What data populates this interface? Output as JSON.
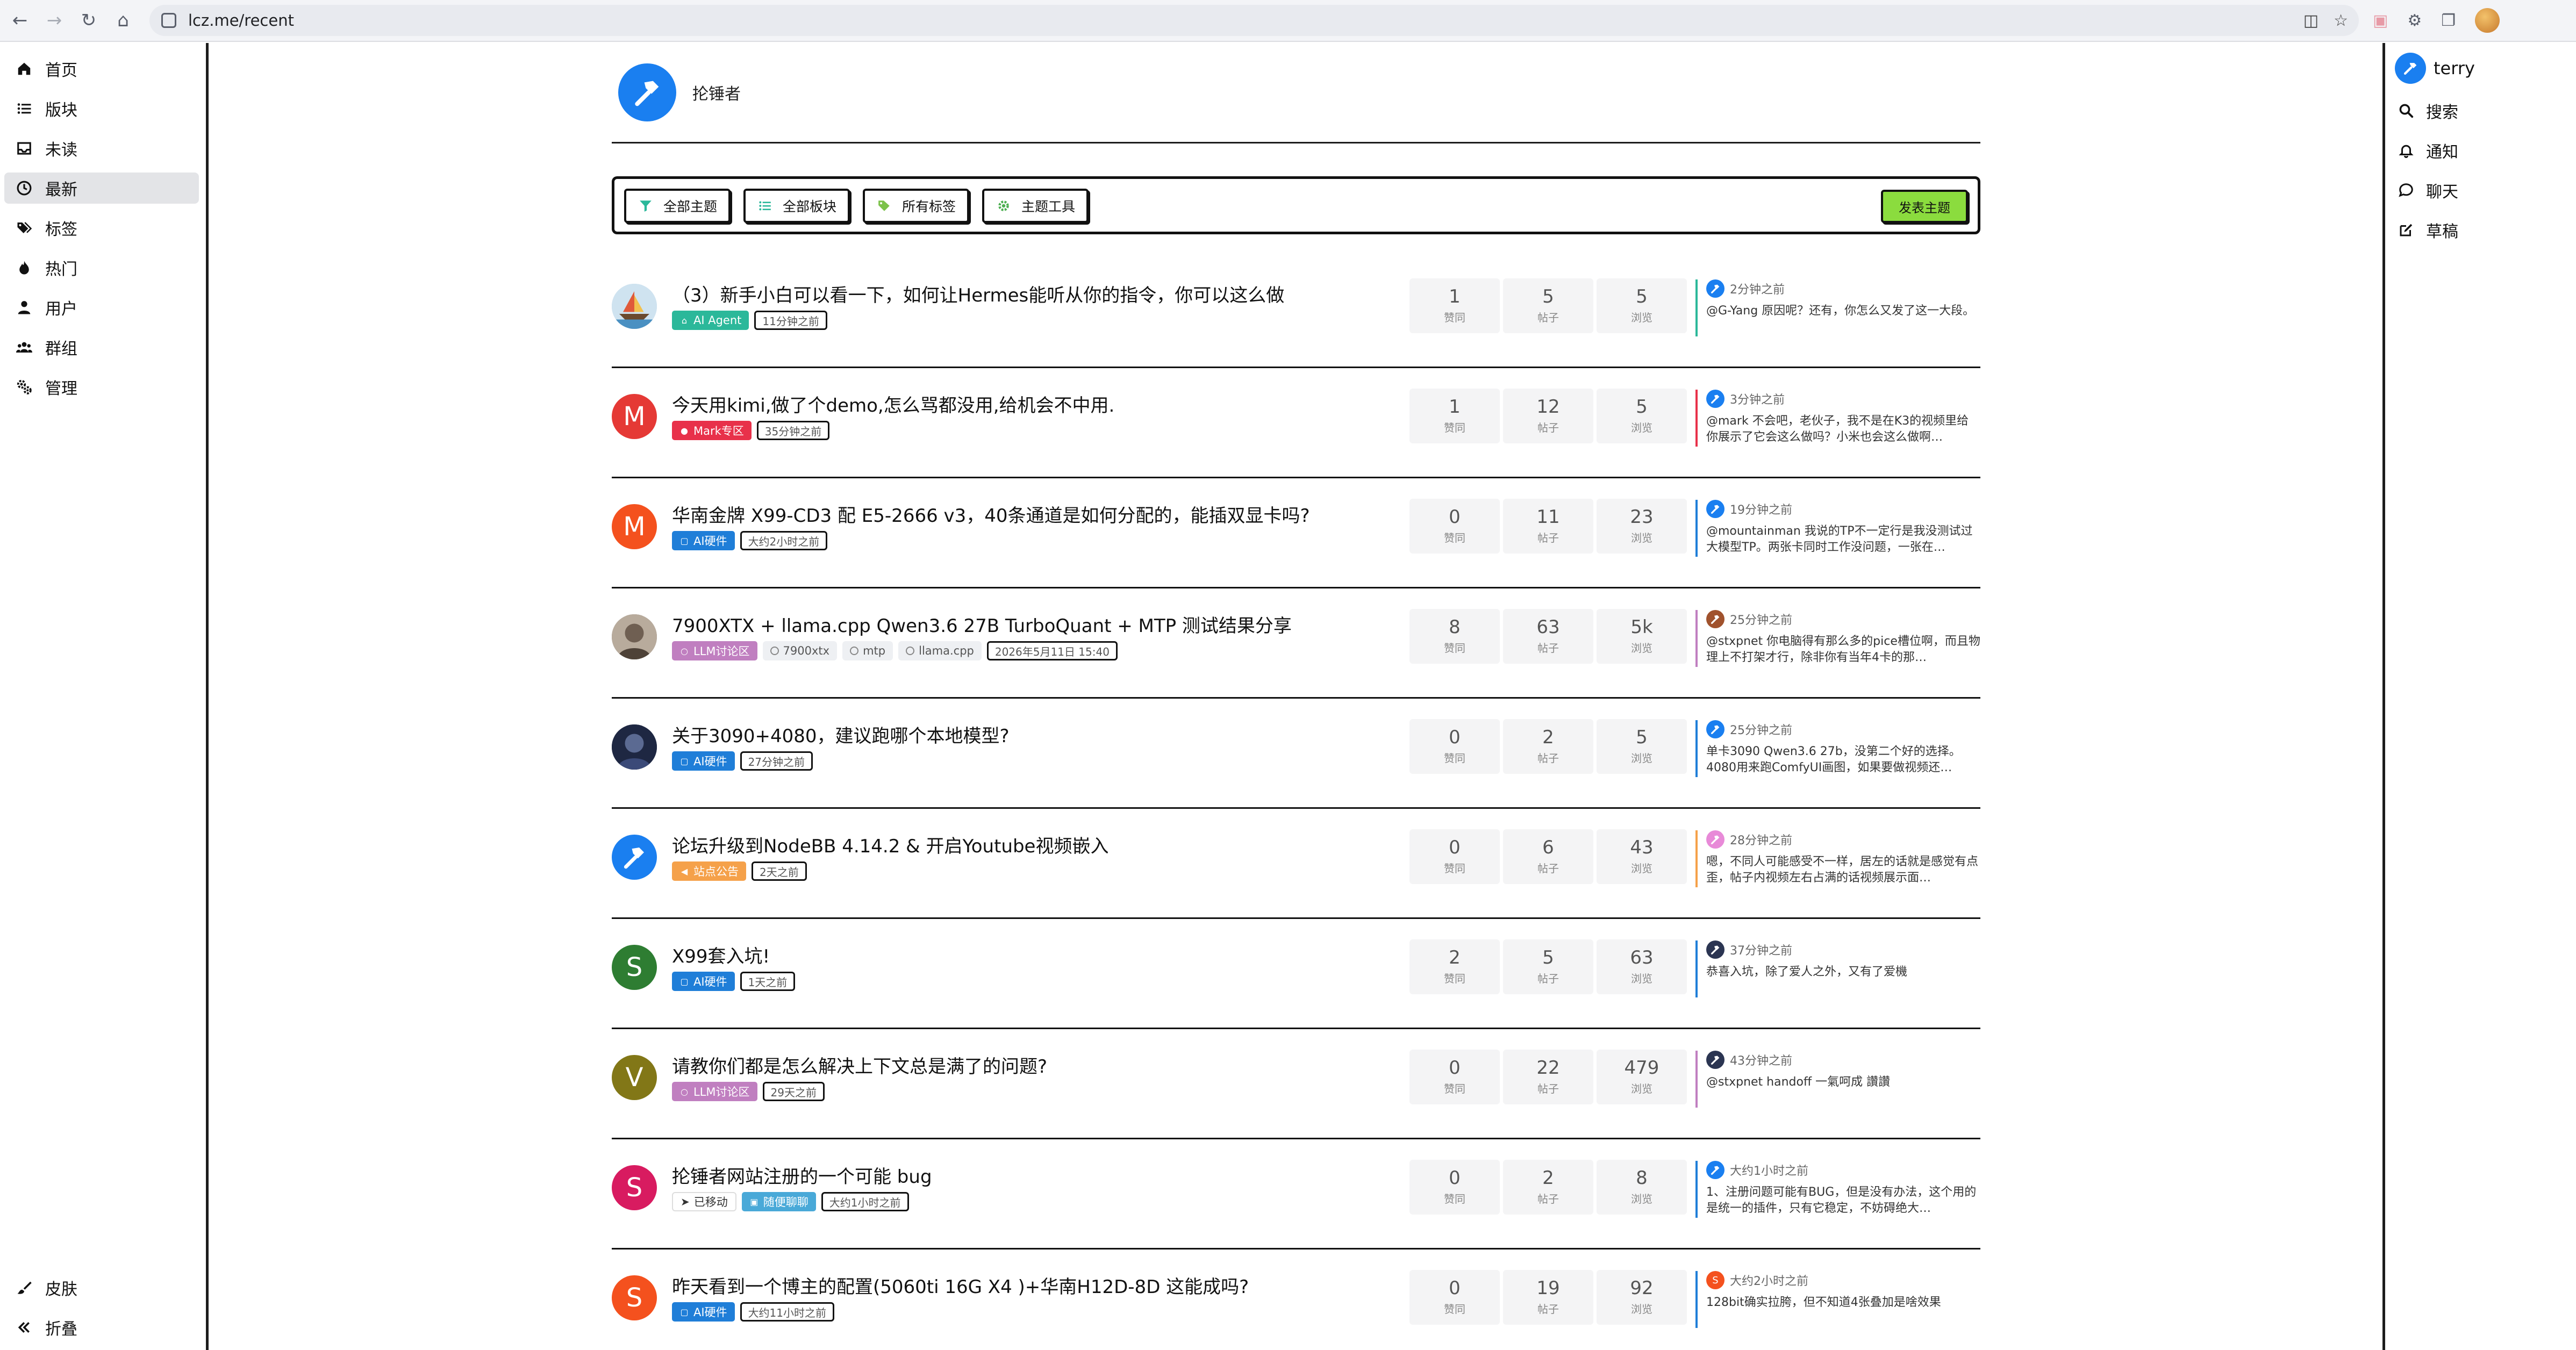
{
  "browser": {
    "url": "lcz.me/recent"
  },
  "left_nav": [
    {
      "id": "home",
      "label": "首页",
      "icon": "home-icon"
    },
    {
      "id": "categories",
      "label": "版块",
      "icon": "list-icon"
    },
    {
      "id": "unread",
      "label": "未读",
      "icon": "inbox-icon"
    },
    {
      "id": "recent",
      "label": "最新",
      "icon": "clock-icon",
      "active": true
    },
    {
      "id": "tags",
      "label": "标签",
      "icon": "tags-icon"
    },
    {
      "id": "popular",
      "label": "热门",
      "icon": "fire-icon"
    },
    {
      "id": "users",
      "label": "用户",
      "icon": "user-icon"
    },
    {
      "id": "groups",
      "label": "群组",
      "icon": "group-icon"
    },
    {
      "id": "admin",
      "label": "管理",
      "icon": "gears-icon"
    }
  ],
  "left_nav_bottom": [
    {
      "id": "skins",
      "label": "皮肤",
      "icon": "brush-icon"
    },
    {
      "id": "collapse",
      "label": "折叠",
      "icon": "double-chevron-left-icon"
    }
  ],
  "right_nav": {
    "username": "terry",
    "items": [
      {
        "id": "search",
        "label": "搜索",
        "icon": "search-icon"
      },
      {
        "id": "notifications",
        "label": "通知",
        "icon": "bell-icon"
      },
      {
        "id": "chat",
        "label": "聊天",
        "icon": "chat-icon"
      },
      {
        "id": "drafts",
        "label": "草稿",
        "icon": "pen-square-icon"
      }
    ]
  },
  "brand": {
    "name": "抡锤者"
  },
  "toolbar": {
    "filters": [
      {
        "id": "all-topics",
        "label": "全部主题",
        "icon": "filter-icon"
      },
      {
        "id": "all-categories",
        "label": "全部板块",
        "icon": "list-icon"
      },
      {
        "id": "all-tags",
        "label": "所有标签",
        "icon": "tag-icon"
      },
      {
        "id": "topic-tools",
        "label": "主题工具",
        "icon": "gear-icon"
      }
    ],
    "new_topic_label": "发表主题"
  },
  "stat_labels": {
    "votes": "赞同",
    "posts": "帖子",
    "views": "浏览"
  },
  "colors": {
    "accent_blue": "#1a7ff0",
    "new_topic_green": "#8bdc3e",
    "cat_ai_agent": "#2bb89a",
    "cat_mark": "#e8314a",
    "cat_ai_hardware": "#1f7ed8",
    "cat_llm": "#c07fc0",
    "cat_announcement": "#f5a14a",
    "cat_chat": "#49a9d8"
  },
  "topics": [
    {
      "title": "（3）新手小白可以看一下，如何让Hermes能听从你的指令，你可以这么做",
      "avatar": {
        "type": "image",
        "letter": "",
        "color": "#b8d4e8",
        "icon": "sailboat-avatar-icon"
      },
      "category": {
        "label": "AI Agent",
        "color": "#2bb89a",
        "icon": "robot-icon"
      },
      "tags": [],
      "time": "11分钟之前",
      "votes": "1",
      "posts": "5",
      "views": "5",
      "last_post": {
        "time": "2分钟之前",
        "text": "@G-Yang 原因呢？还有，你怎么又发了这一大段。",
        "avatar_color": "#1a7ff0",
        "avatar_letter": "",
        "border": "#2bb89a"
      }
    },
    {
      "title": "今天用kimi,做了个demo,怎么骂都没用,给机会不中用.",
      "avatar": {
        "type": "letter",
        "letter": "M",
        "color": "#e53935"
      },
      "category": {
        "label": "Mark专区",
        "color": "#e8314a",
        "icon": "person-icon"
      },
      "tags": [],
      "time": "35分钟之前",
      "votes": "1",
      "posts": "12",
      "views": "5",
      "last_post": {
        "time": "3分钟之前",
        "text": "@mark 不会吧，老伙子，我不是在K3的视频里给你展示了它会这么做吗？小米也会这么做啊…",
        "avatar_color": "#1a7ff0",
        "avatar_letter": "",
        "border": "#e8314a"
      }
    },
    {
      "title": "华南金牌 X99-CD3 配 E5-2666 v3，40条通道是如何分配的，能插双显卡吗?",
      "avatar": {
        "type": "letter",
        "letter": "M",
        "color": "#f4511e"
      },
      "category": {
        "label": "AI硬件",
        "color": "#1f7ed8",
        "icon": "monitor-icon"
      },
      "tags": [],
      "time": "大约2小时之前",
      "votes": "0",
      "posts": "11",
      "views": "23",
      "last_post": {
        "time": "19分钟之前",
        "text": "@mountainman 我说的TP不一定行是我没测试过大模型TP。两张卡同时工作没问题，一张在…",
        "avatar_color": "#1a7ff0",
        "avatar_letter": "",
        "border": "#1f7ed8"
      }
    },
    {
      "title": "7900XTX + llama.cpp Qwen3.6 27B TurboQuant + MTP 测试结果分享",
      "avatar": {
        "type": "image",
        "letter": "",
        "color": "#8a7f74",
        "icon": "person-photo-avatar-icon"
      },
      "category": {
        "label": "LLM讨论区",
        "color": "#c07fc0",
        "icon": "circle-icon"
      },
      "tags": [
        "7900xtx",
        "mtp",
        "llama.cpp"
      ],
      "time": "2026年5月11日 15:40",
      "votes": "8",
      "posts": "63",
      "views": "5k",
      "last_post": {
        "time": "25分钟之前",
        "text": "@stxpnet 你电脑得有那么多的pice槽位啊，而且物理上不打架才行，除非你有当年4卡的那…",
        "avatar_color": "#a0522d",
        "avatar_letter": "",
        "border": "#c07fc0"
      }
    },
    {
      "title": "关于3090+4080，建议跑哪个本地模型?",
      "avatar": {
        "type": "image",
        "letter": "",
        "color": "#2b3552",
        "icon": "dark-photo-avatar-icon"
      },
      "category": {
        "label": "AI硬件",
        "color": "#1f7ed8",
        "icon": "monitor-icon"
      },
      "tags": [],
      "time": "27分钟之前",
      "votes": "0",
      "posts": "2",
      "views": "5",
      "last_post": {
        "time": "25分钟之前",
        "text": "单卡3090 Qwen3.6 27b，没第二个好的选择。4080用来跑ComfyUI画图，如果要做视频还…",
        "avatar_color": "#1a7ff0",
        "avatar_letter": "",
        "border": "#1f7ed8"
      }
    },
    {
      "title": "论坛升级到NodeBB 4.14.2 & 开启Youtube视频嵌入",
      "avatar": {
        "type": "logo",
        "letter": "",
        "color": "#1a7ff0",
        "icon": "hammer-icon"
      },
      "category": {
        "label": "站点公告",
        "color": "#f5a14a",
        "icon": "megaphone-icon"
      },
      "tags": [],
      "time": "2天之前",
      "votes": "0",
      "posts": "6",
      "views": "43",
      "last_post": {
        "time": "28分钟之前",
        "text": "嗯，不同人可能感受不一样，居左的话就是感觉有点歪，帖子内视频左右占满的话视频展示面…",
        "avatar_color": "#e88ad8",
        "avatar_letter": "",
        "border": "#f5a14a"
      }
    },
    {
      "title": "X99套入坑!",
      "avatar": {
        "type": "letter",
        "letter": "S",
        "color": "#2e7d32"
      },
      "category": {
        "label": "AI硬件",
        "color": "#1f7ed8",
        "icon": "monitor-icon"
      },
      "tags": [],
      "time": "1天之前",
      "votes": "2",
      "posts": "5",
      "views": "63",
      "last_post": {
        "time": "37分钟之前",
        "text": "恭喜入坑，除了爱人之外，又有了爱機",
        "avatar_color": "#2b3552",
        "avatar_letter": "",
        "border": "#1f7ed8"
      }
    },
    {
      "title": "请教你们都是怎么解决上下文总是满了的问题?",
      "avatar": {
        "type": "letter",
        "letter": "V",
        "color": "#827717"
      },
      "category": {
        "label": "LLM讨论区",
        "color": "#c07fc0",
        "icon": "circle-icon"
      },
      "tags": [],
      "time": "29天之前",
      "votes": "0",
      "posts": "22",
      "views": "479",
      "last_post": {
        "time": "43分钟之前",
        "text": "@stxpnet handoff 一氣呵成 讚讚",
        "avatar_color": "#2b3552",
        "avatar_letter": "",
        "border": "#c07fc0"
      }
    },
    {
      "title": "抡锤者网站注册的一个可能 bug",
      "avatar": {
        "type": "letter",
        "letter": "S",
        "color": "#d81b60"
      },
      "category": {
        "label": "随便聊聊",
        "color": "#49a9d8",
        "icon": "chat-bubbles-icon"
      },
      "moved_label": "已移动",
      "tags": [],
      "time": "大约1小时之前",
      "votes": "0",
      "posts": "2",
      "views": "8",
      "last_post": {
        "time": "大约1小时之前",
        "text": "1、注册问题可能有BUG，但是没有办法，这个用的是统一的插件，只有它稳定，不妨碍绝大…",
        "avatar_color": "#1a7ff0",
        "avatar_letter": "",
        "border": "#1f7ed8"
      }
    },
    {
      "title": "昨天看到一个博主的配置(5060ti 16G X4 )+华南H12D-8D 这能成吗?",
      "avatar": {
        "type": "letter",
        "letter": "S",
        "color": "#f4511e"
      },
      "category": {
        "label": "AI硬件",
        "color": "#1f7ed8",
        "icon": "monitor-icon"
      },
      "tags": [],
      "time": "大约11小时之前",
      "votes": "0",
      "posts": "19",
      "views": "92",
      "last_post": {
        "time": "大约2小时之前",
        "text": "128bit确实拉胯，但不知道4张叠加是啥效果",
        "avatar_color": "#f4511e",
        "avatar_letter": "S",
        "border": "#1f7ed8"
      }
    }
  ]
}
